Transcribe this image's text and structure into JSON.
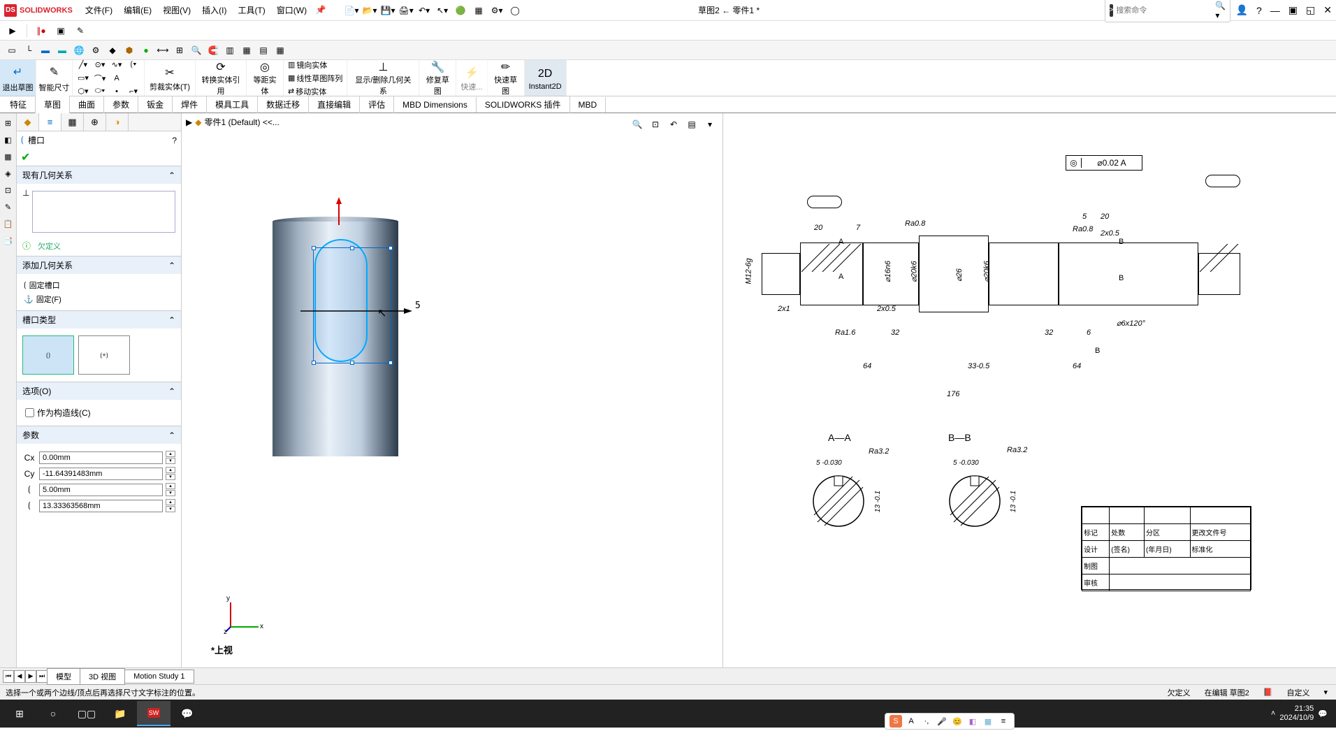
{
  "app": {
    "logo_text": "SOLIDWORKS",
    "doc_title": "草图2 ← 零件1 *"
  },
  "menu": [
    "文件(F)",
    "编辑(E)",
    "视图(V)",
    "插入(I)",
    "工具(T)",
    "窗口(W)"
  ],
  "search": {
    "placeholder": "搜索命令"
  },
  "ribbon": {
    "exit_sketch": "退出草图",
    "smart_dim": "智能尺寸",
    "trim": "剪裁实体(T)",
    "convert": "转换实体引用",
    "offset": "等距实体",
    "mirror": "镜向实体",
    "pattern": "线性草图阵列",
    "move": "移动实体",
    "show_rel": "显示/删除几何关系",
    "repair": "修复草图",
    "quick": "快速...",
    "rapid": "快速草图",
    "instant": "Instant2D"
  },
  "tabs": [
    "特征",
    "草图",
    "曲面",
    "参数",
    "钣金",
    "焊件",
    "模具工具",
    "数据迁移",
    "直接编辑",
    "评估",
    "MBD Dimensions",
    "SOLIDWORKS 插件",
    "MBD"
  ],
  "breadcrumb": "零件1 (Default) <<...",
  "pm": {
    "title": "槽口",
    "sec_relations": "现有几何关系",
    "underdefined": "欠定义",
    "sec_add_rel": "添加几何关系",
    "fix_slot": "固定槽口",
    "fix": "固定(F)",
    "sec_slot_type": "槽口类型",
    "sec_options": "选项(O)",
    "construction": "作为构造线(C)",
    "sec_params": "参数",
    "params": [
      "0.00mm",
      "-11.64391483mm",
      "5.00mm",
      "13.33363568mm"
    ]
  },
  "view_triad": "*上视",
  "dimension_5": "5",
  "bottom_tabs": [
    "模型",
    "3D 视图",
    "Motion Study 1"
  ],
  "status": {
    "hint": "选择一个或两个边线/顶点后再选择尺寸文字标注的位置。",
    "underdefined": "欠定义",
    "editing": "在编辑 草图2",
    "custom": "自定义"
  },
  "drawing": {
    "gdt": "⌀0.02  A",
    "dims": {
      "d1": "20",
      "d2": "7",
      "d3": "Ra0.8",
      "d4": "A",
      "d5": "M12-6g",
      "d6": "⌀16n6",
      "d7": "⌀20k6",
      "d8": "⌀26",
      "d9": "⌀20k6",
      "d10": "2x1",
      "d11": "2x0.5",
      "d12": "Ra1.6",
      "d13": "32",
      "d14": "33-0.5",
      "d15": "32",
      "d16": "6",
      "d17": "64",
      "d18": "64",
      "d19": "176",
      "d20": "5",
      "d21": "20",
      "d22": "Ra0.8",
      "d23": "2x0.5",
      "d24": "B",
      "d25": "B",
      "d26": "⌀6x120°",
      "secA": "A—A",
      "secB": "B—B",
      "ra32a": "Ra3.2",
      "ra32b": "Ra3.2",
      "s5a": "5 -0.030",
      "s5b": "5 -0.030",
      "h13a": "13 -0.1",
      "h13b": "13 -0.1"
    },
    "table": {
      "r1c1": "标记",
      "r1c2": "处数",
      "r1c3": "分区",
      "r1c4": "更改文件号",
      "r2c1": "设计",
      "r2c2": "(签名)",
      "r2c3": "(年月日)",
      "r2c4": "标准化",
      "r3c1": "制图",
      "r4c1": "审核"
    }
  },
  "taskbar": {
    "time": "21:35",
    "date": "2024/10/9"
  }
}
